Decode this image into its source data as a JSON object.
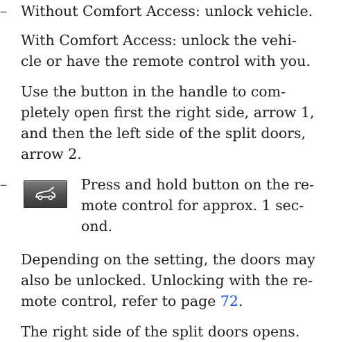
{
  "step1": {
    "bullet": "–",
    "line1": "Without Comfort Access: unlock vehicle.",
    "para2": [
      "With Comfort Access: unlock the vehi-",
      "cle or have the remote control with you."
    ],
    "para3": [
      "Use the button in the handle to com-",
      "pletely open first the right side, arrow 1,",
      "and then the left side of the split doors,",
      "arrow 2."
    ]
  },
  "step2": {
    "bullet": "–",
    "icon": "tailgate-open-key-icon",
    "button_text": [
      "Press and hold button on the re-",
      "mote control for approx. 1 sec-",
      "ond."
    ],
    "para2_line1": "Depending on the setting, the doors may",
    "para2_line2_prefix": "also be unlocked. Unlocking with the re-",
    "para2_line3_prefix": "mote control, refer to page ",
    "page_ref": "72",
    "para2_line3_suffix": ".",
    "para3": "The right side of the split doors opens."
  },
  "colors": {
    "text": "#222222",
    "link": "#1a4fd6",
    "icon_bg": "#4e4e4e"
  }
}
